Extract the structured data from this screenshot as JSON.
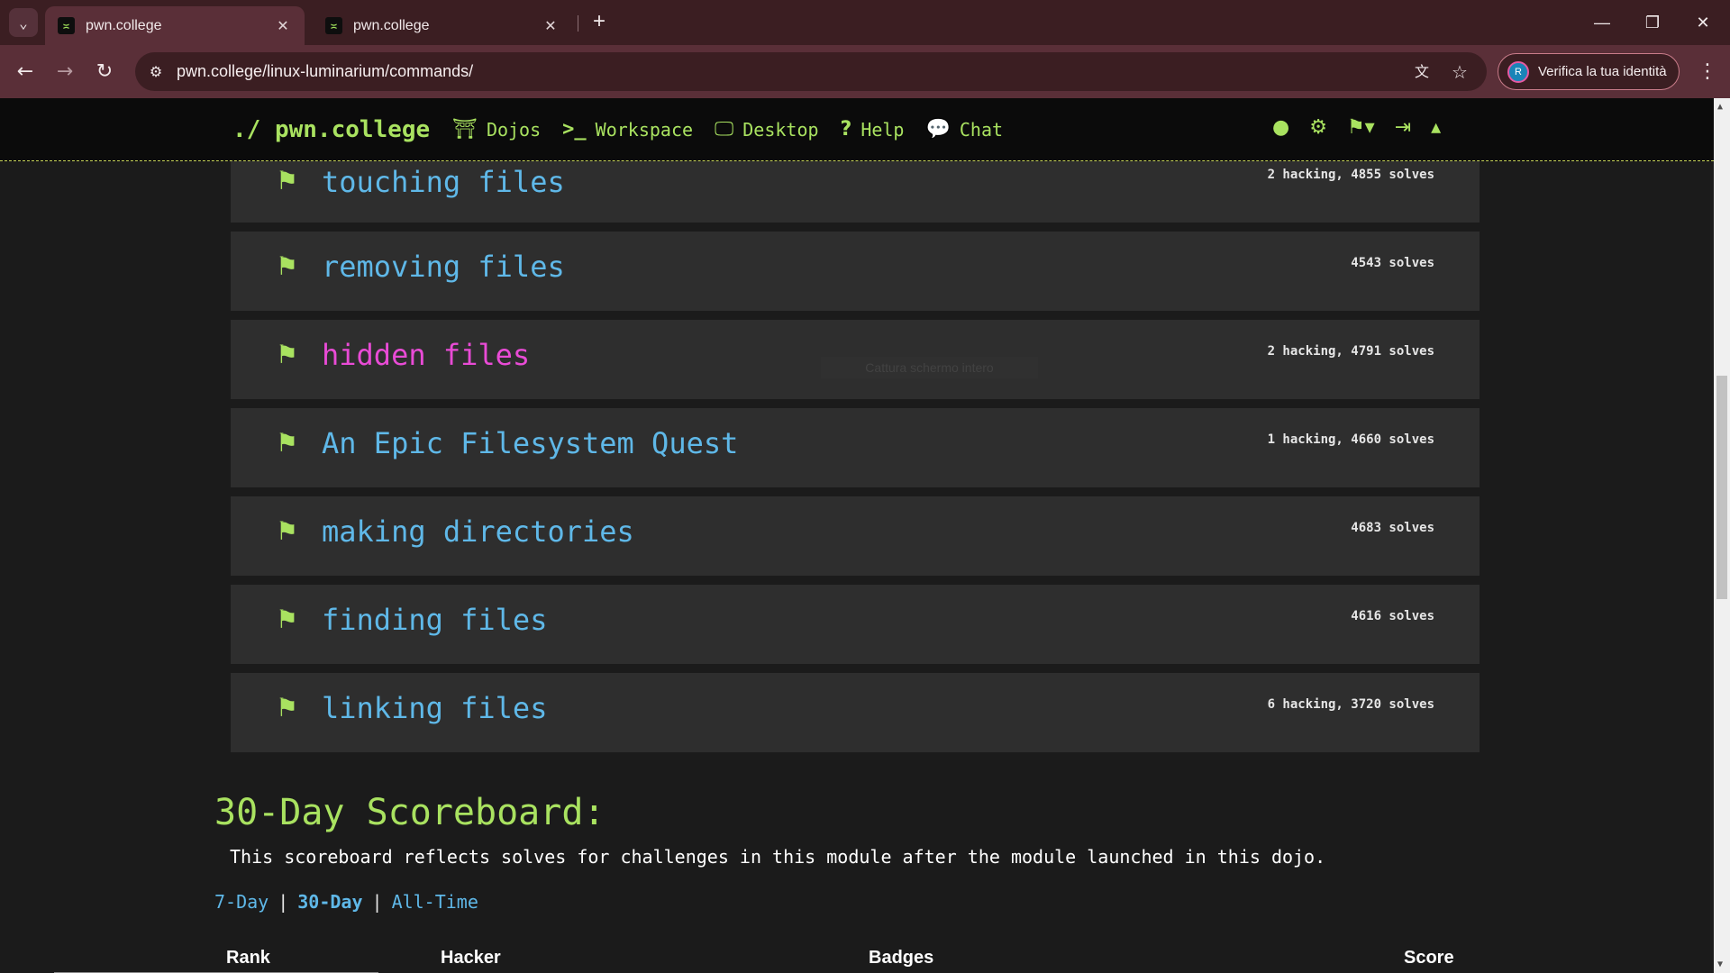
{
  "browser": {
    "tabs": [
      {
        "title": "pwn.college",
        "active": true
      },
      {
        "title": "pwn.college",
        "active": false
      }
    ],
    "url": "pwn.college/linux-luminarium/commands/",
    "profile_button": "Verifica la tua identità",
    "profile_initial": "R",
    "tab_close_glyph": "✕",
    "new_tab_glyph": "+"
  },
  "site_nav": {
    "brand": "./ pwn.college",
    "links": [
      {
        "label": "Dojos",
        "icon": "dojo-gate-icon",
        "glyph": "⛩"
      },
      {
        "label": "Workspace",
        "icon": "terminal-icon",
        "glyph": ">_"
      },
      {
        "label": "Desktop",
        "icon": "desktop-icon",
        "glyph": "🖵"
      },
      {
        "label": "Help",
        "icon": "question-icon",
        "glyph": "?"
      },
      {
        "label": "Chat",
        "icon": "chat-icon",
        "glyph": "💬"
      }
    ]
  },
  "challenges": [
    {
      "name": "touching files",
      "solves": "2 hacking, 4855 solves",
      "highlight": false
    },
    {
      "name": "removing files",
      "solves": "4543 solves",
      "highlight": false
    },
    {
      "name": "hidden files",
      "solves": "2 hacking, 4791 solves",
      "highlight": true
    },
    {
      "name": "An Epic Filesystem Quest",
      "solves": "1 hacking, 4660 solves",
      "highlight": false
    },
    {
      "name": "making directories",
      "solves": "4683 solves",
      "highlight": false
    },
    {
      "name": "finding files",
      "solves": "4616 solves",
      "highlight": false
    },
    {
      "name": "linking files",
      "solves": "6 hacking, 3720 solves",
      "highlight": false
    }
  ],
  "ghost_tooltip": "Cattura schermo intero",
  "scoreboard": {
    "title": "30-Day Scoreboard:",
    "description": "This scoreboard reflects solves for challenges in this module after the module launched in this dojo.",
    "periods": [
      "7-Day",
      "30-Day",
      "All-Time"
    ],
    "selected_period": "30-Day",
    "separator": "|",
    "columns": [
      "Rank",
      "Hacker",
      "Badges",
      "Score"
    ]
  },
  "colors": {
    "accent_green": "#a9e260",
    "link_blue": "#5fb8e8",
    "highlight_pink": "#e94bd6",
    "card_bg": "#2e2e2e",
    "page_bg": "#1b1b1b",
    "browser_toolbar": "#5a2f38"
  }
}
